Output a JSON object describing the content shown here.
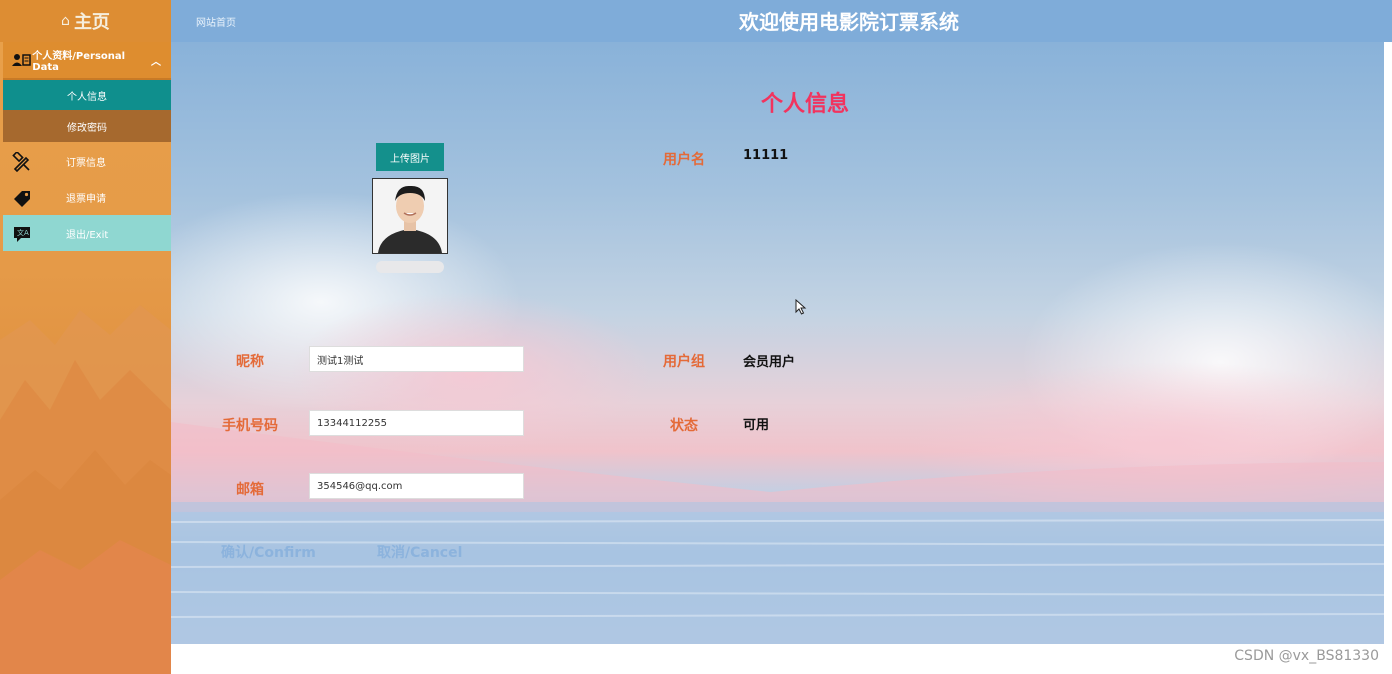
{
  "sidebar": {
    "home_label": "主页",
    "personal_menu_label": "个人资料/Personal Data",
    "sub_items": [
      "个人信息",
      "修改密码"
    ],
    "items": [
      "订票信息",
      "退票申请",
      "退出/Exit"
    ]
  },
  "header": {
    "home_link": "网站首页",
    "title": "欢迎使用电影院订票系统"
  },
  "main": {
    "section_title": "个人信息",
    "upload_label": "上传图片",
    "fields": {
      "username_label": "用户名",
      "username_value": "11111",
      "nickname_label": "昵称",
      "nickname_value": "测试1测试",
      "usergroup_label": "用户组",
      "usergroup_value": "会员用户",
      "phone_label": "手机号码",
      "phone_value": "13344112255",
      "status_label": "状态",
      "status_value": "可用",
      "email_label": "邮箱",
      "email_value": "354546@qq.com"
    },
    "confirm_label": "确认/Confirm",
    "cancel_label": "取消/Cancel"
  },
  "watermark": "CSDN @vx_BS81330",
  "colors": {
    "sidebar": "#e59a48",
    "active_item": "#0f8f8d",
    "header": "#7facd9",
    "title_red": "#f2335e",
    "label_orange": "#e46a38"
  }
}
